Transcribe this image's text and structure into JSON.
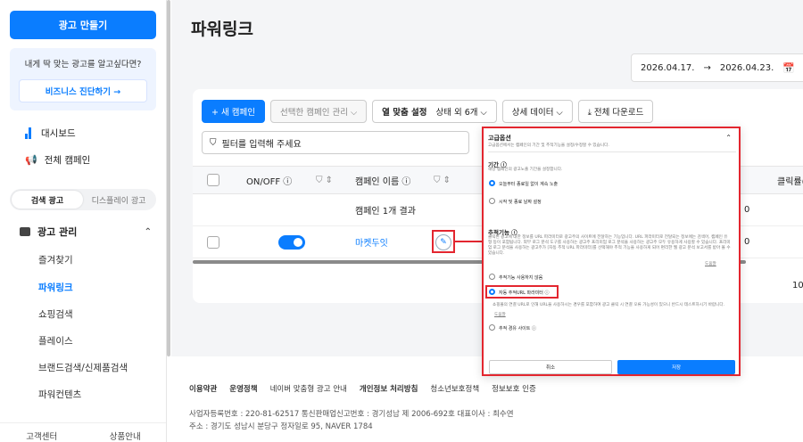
{
  "sidebar": {
    "create_btn": "광고 만들기",
    "promo_text": "내게 딱 맞는 광고를 알고싶다면?",
    "promo_btn": "비즈니스 진단하기 →",
    "dashboard": "대시보드",
    "all_campaigns": "전체 캠페인",
    "tabs": [
      "검색 광고",
      "디스플레이 광고"
    ],
    "group": "광고 관리",
    "items": [
      "즐겨찾기",
      "파워링크",
      "쇼핑검색",
      "플레이스",
      "브랜드검색/신제품검색",
      "파워컨텐츠"
    ],
    "footer": [
      "고객센터",
      "상품안내"
    ]
  },
  "main": {
    "title": "파워링크",
    "date_from": "2026.04.17.",
    "date_arrow": "→",
    "date_to": "2026.04.23.",
    "toolbar": {
      "new_campaign": "+ 새 캠페인",
      "manage": "선택한 캠페인 관리 ⌵",
      "columns_label": "열 맞춤 설정",
      "columns_value": "상태 외 6개 ⌵",
      "detail": "상세 데이터 ⌵",
      "download": "⤓ 전체 다운로드"
    },
    "filter_placeholder": "필터를 입력해 주세요",
    "table": {
      "col_onoff": "ON/OFF ⓘ",
      "col_name": "캠페인 이름 ⓘ",
      "col_click": "클릭률(",
      "summary": "캠페인 1개 결과",
      "campaign_name": "마켓두잇",
      "zero1": "0",
      "zero2": "0",
      "right_val": "10"
    }
  },
  "footer": {
    "links": [
      "이용약관",
      "운영정책",
      "네이버 맞춤형 광고 안내",
      "개인정보 처리방침",
      "청소년보호정책",
      "정보보호 인증"
    ],
    "bold_links": [
      0,
      1,
      3
    ],
    "info1": "사업자등록번호 : 220-81-62517     통신판매업신고번호 : 경기성남 제 2006-692호     대표이사 : 최수연",
    "info2": "주소 : 경기도 성남시 분당구 정자일로 95, NAVER 1784"
  },
  "modal": {
    "title": "고급옵션",
    "subtitle": "고급옵션에서는 캠페인의 기간 및 추적기능을 설정/수정할 수 있습니다.",
    "period_title": "기간 ⓘ",
    "period_desc": "해당 캠페인의 광고노출 기간을 설정합니다.",
    "period_opt1": "오늘부터 종료일 없이 계속 노출",
    "period_opt2": "시작 및 종료 날짜 설정",
    "track_title": "추적기능 ⓘ",
    "track_desc": "클릭된 광고에 대한 정보를 URL 파라미터로 광고주의 사이트에 전달하는 기능입니다. URL 파라미터로 전달되는 정보에는 검색어, 캠페인 유형 등이 포함됩니다. 외부 로그 분석 도구를 사용하는 광고주 프리미엄 로그 분석을 사용하는 광고주 모두 유용하게 사용할 수 있습니다. 프리미엄 로그 분석을 사용하는 광고주가 [자동 추적 URL 파라미터]를 선택해야 추적 기능을 사용하게 되어 편리한 웹 광고 분석 보고서를 받아 볼 수 있습니다.",
    "track_help": "도움말",
    "track_opt1": "추적기능 사용하지 않음",
    "track_opt2": "자동 추적URL 파라미터 ⓘ",
    "track_opt2_desc": "쇼핑몰의 연결 URL로 인해 URL을 사용하시는 경우를 포함하여 광고 클릭 시 연결 오류 가능성이 있으니 반드시 테스트하시기 바랍니다.",
    "track_opt2_help": "도움말",
    "track_opt3": "추적 경유 사이트 ⓘ",
    "cancel": "취소",
    "save": "저장",
    "collapse": "⌃"
  }
}
